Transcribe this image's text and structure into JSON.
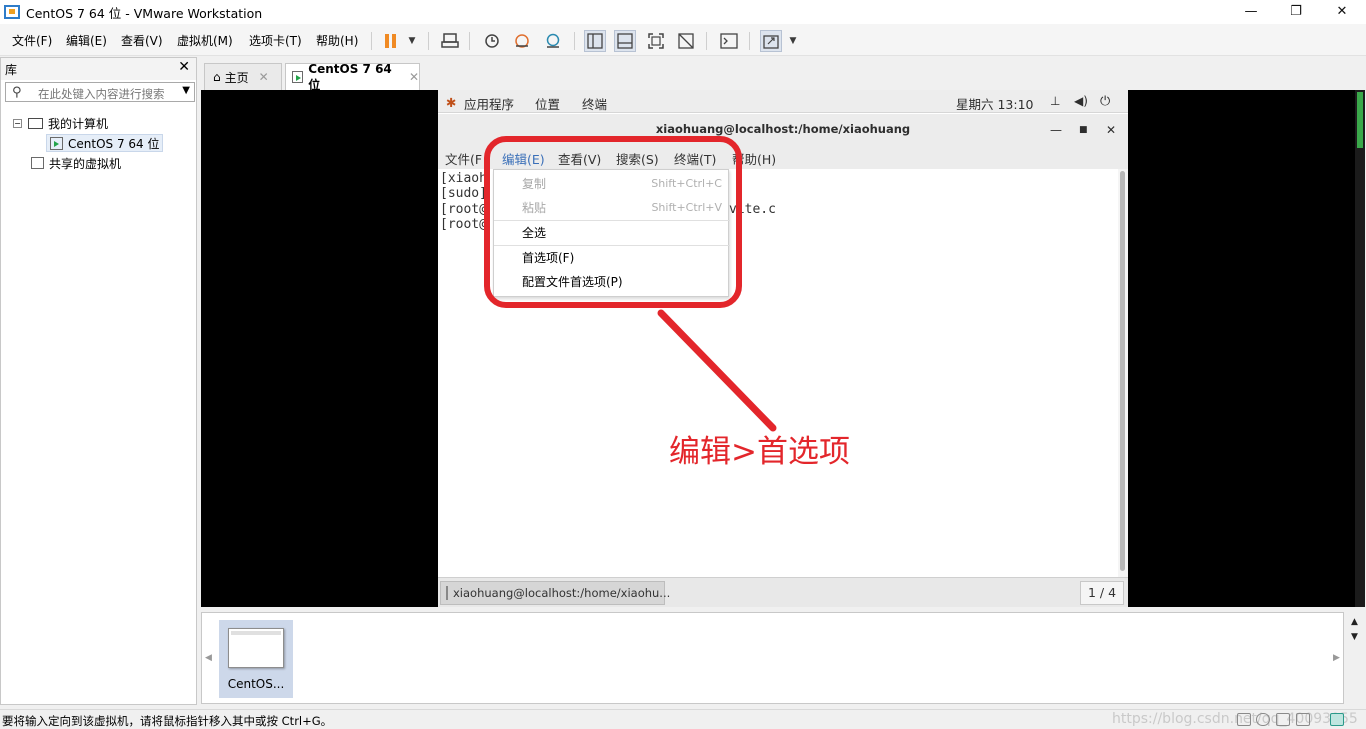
{
  "window": {
    "title": "CentOS 7 64 位 - VMware Workstation",
    "minimize": "—",
    "restore": "❐",
    "close": "✕"
  },
  "menubar": {
    "items": [
      "文件(F)",
      "编辑(E)",
      "查看(V)",
      "虚拟机(M)",
      "选项卡(T)",
      "帮助(H)"
    ]
  },
  "toolbar": {
    "pause_icon": "pause-icon",
    "accent": "#f08a24"
  },
  "library": {
    "title": "库",
    "close": "✕",
    "search_placeholder": "在此处键入内容进行搜索",
    "tree": {
      "my_computer": "我的计算机",
      "vm": "CentOS 7 64 位",
      "shared": "共享的虚拟机"
    }
  },
  "tabs": [
    {
      "label": "主页",
      "close": "✕"
    },
    {
      "label": "CentOS 7 64 位",
      "close": "✕"
    }
  ],
  "gnome": {
    "topbar": {
      "apps": "应用程序",
      "places": "位置",
      "terminal": "终端",
      "clock": "星期六 13:10"
    },
    "terminal_title": "xiaohuang@localhost:/home/xiaohuang",
    "term_menu": {
      "file": "文件(F",
      "edit": "编辑(E)",
      "view": "查看(V)",
      "search": "搜索(S)",
      "terminal": "终端(T)",
      "help": "帮助(H)"
    },
    "term_lines": [
      "[xiaoh",
      "[sudo]",
      "[root@",
      "[root@"
    ],
    "term_fragment": "vite.c",
    "edit_menu": {
      "copy": "复制",
      "copy_shortcut": "Shift+Ctrl+C",
      "paste": "粘贴",
      "paste_shortcut": "Shift+Ctrl+V",
      "select_all": "全选",
      "preferences": "首选项(F)",
      "profile_prefs": "配置文件首选项(P)"
    },
    "task_label": "xiaohuang@localhost:/home/xiaohu...",
    "pager": "1 / 4"
  },
  "annotation": {
    "text": "编辑>首选项",
    "color": "#e3262b"
  },
  "thumbnail": {
    "label": "CentOS..."
  },
  "statusbar": {
    "text": "要将输入定向到该虚拟机，请将鼠标指针移入其中或按 Ctrl+G。",
    "watermark": "https://blog.csdn.net/qq_40093955"
  }
}
